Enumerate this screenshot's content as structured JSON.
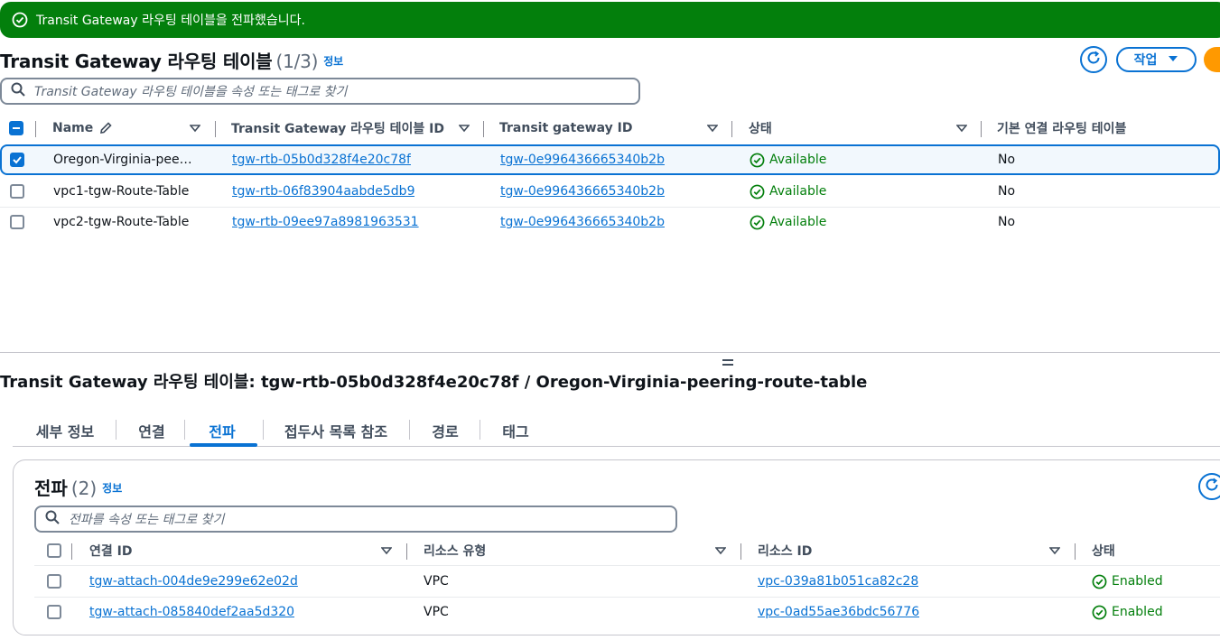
{
  "flash": {
    "message": "Transit Gateway 라우팅 테이블을 전파했습니다."
  },
  "top": {
    "title": "Transit Gateway 라우팅 테이블",
    "count": "(1/3)",
    "info": "정보",
    "action_label": "작업",
    "search_placeholder": "Transit Gateway 라우팅 테이블을 속성 또는 태그로 찾기",
    "columns": [
      "Name",
      "Transit Gateway 라우팅 테이블 ID",
      "Transit gateway ID",
      "상태",
      "기본 연결 라우팅 테이블"
    ],
    "rows": [
      {
        "name": "Oregon-Virginia-pee…",
        "rtb_id": "tgw-rtb-05b0d328f4e20c78f",
        "tgw_id": "tgw-0e996436665340b2b",
        "status": "Available",
        "default_assoc": "No",
        "selected": true
      },
      {
        "name": "vpc1-tgw-Route-Table",
        "rtb_id": "tgw-rtb-06f83904aabde5db9",
        "tgw_id": "tgw-0e996436665340b2b",
        "status": "Available",
        "default_assoc": "No",
        "selected": false
      },
      {
        "name": "vpc2-tgw-Route-Table",
        "rtb_id": "tgw-rtb-09ee97a8981963531",
        "tgw_id": "tgw-0e996436665340b2b",
        "status": "Available",
        "default_assoc": "No",
        "selected": false
      }
    ]
  },
  "detail": {
    "title": "Transit Gateway 라우팅 테이블: tgw-rtb-05b0d328f4e20c78f / Oregon-Virginia-peering-route-table",
    "tabs": [
      "세부 정보",
      "연결",
      "전파",
      "접두사 목록 참조",
      "경로",
      "태그"
    ],
    "active_tab": "전파"
  },
  "propagation": {
    "title": "전파",
    "count": "(2)",
    "info": "정보",
    "search_placeholder": "전파를 속성 또는 태그로 찾기",
    "columns": [
      "연결 ID",
      "리소스 유형",
      "리소스 ID",
      "상태"
    ],
    "rows": [
      {
        "attach_id": "tgw-attach-004de9e299e62e02d",
        "resource_type": "VPC",
        "resource_id": "vpc-039a81b051ca82c28",
        "status": "Enabled"
      },
      {
        "attach_id": "tgw-attach-085840def2aa5d320",
        "resource_type": "VPC",
        "resource_id": "vpc-0ad55ae36bdc56776",
        "status": "Enabled"
      }
    ]
  },
  "colors": {
    "success": "#037f0c",
    "link": "#0972d3",
    "accent": "#ff9900"
  }
}
